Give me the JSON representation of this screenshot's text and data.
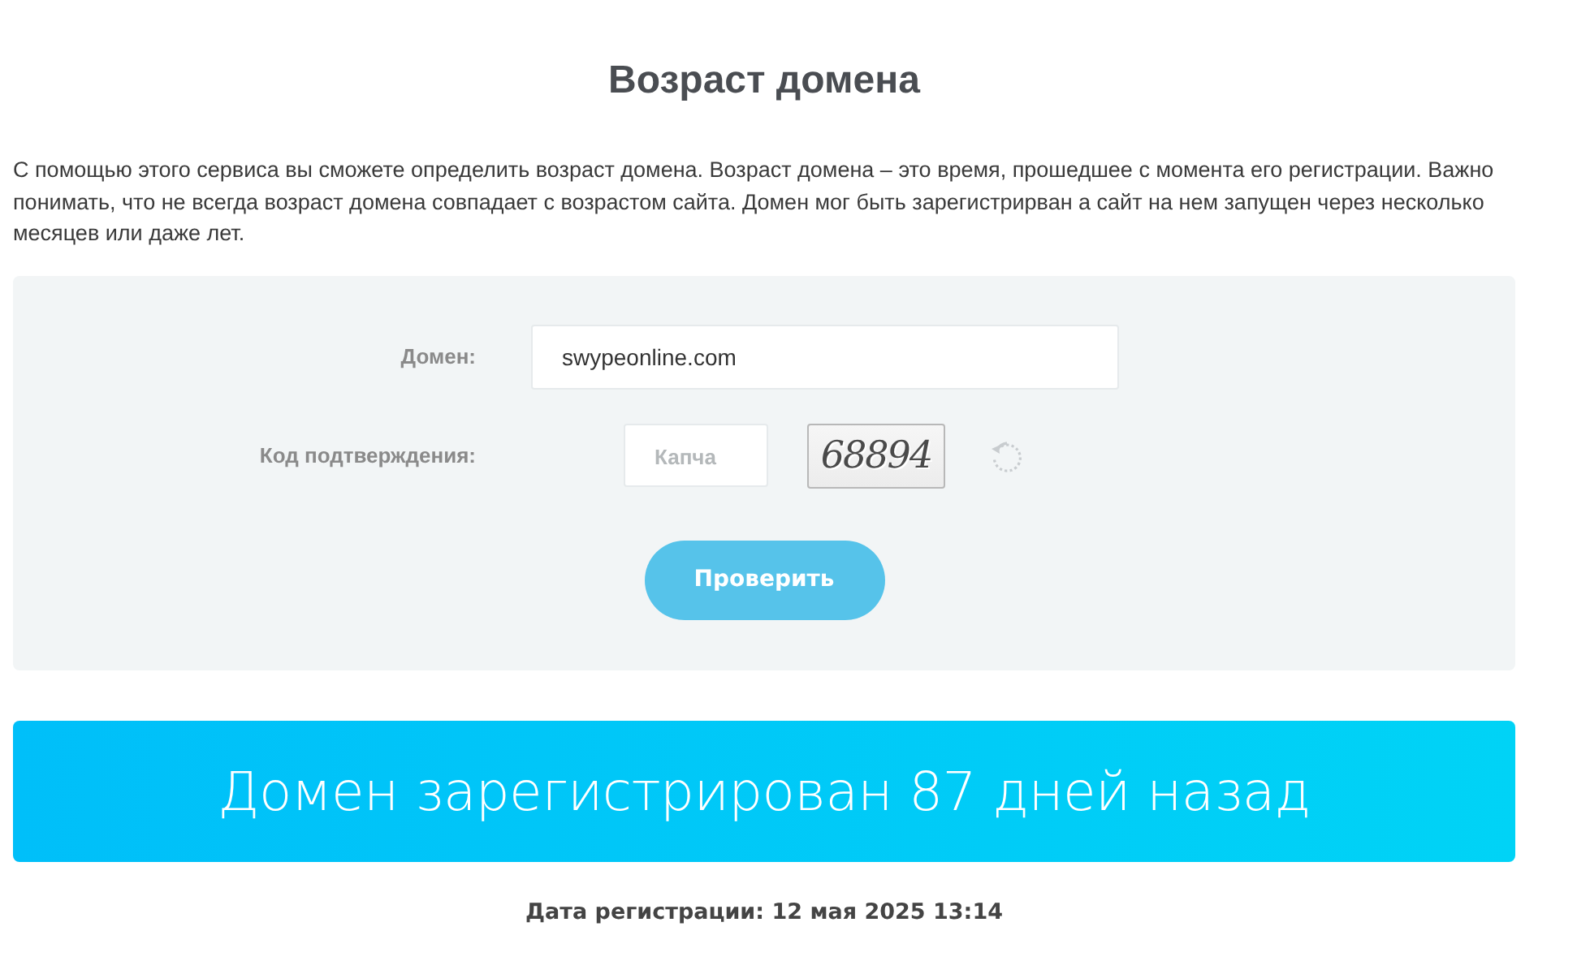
{
  "page": {
    "title": "Возраст домена",
    "description": "С помощью этого сервиса вы сможете определить возраст домена. Возраст домена – это время, прошедшее с момента его регистрации. Важно понимать, что не всегда возраст домена совпадает с возрастом сайта. Домен мог быть зарегистрирван а сайт на нем запущен через несколько месяцев или даже лет."
  },
  "form": {
    "fields": [
      {
        "kind": "text",
        "label": "Домен:",
        "value": "swypeonline.com"
      },
      {
        "kind": "captcha",
        "label": "Код подтверждения:",
        "placeholder": "Капча",
        "captcha_code": "68894"
      }
    ],
    "submit_button": "Проверить"
  },
  "result": {
    "banner": "Домен зарегистрирован 87 дней назад",
    "registration_date": "Дата регистрации: 12 мая 2025 13:14"
  }
}
